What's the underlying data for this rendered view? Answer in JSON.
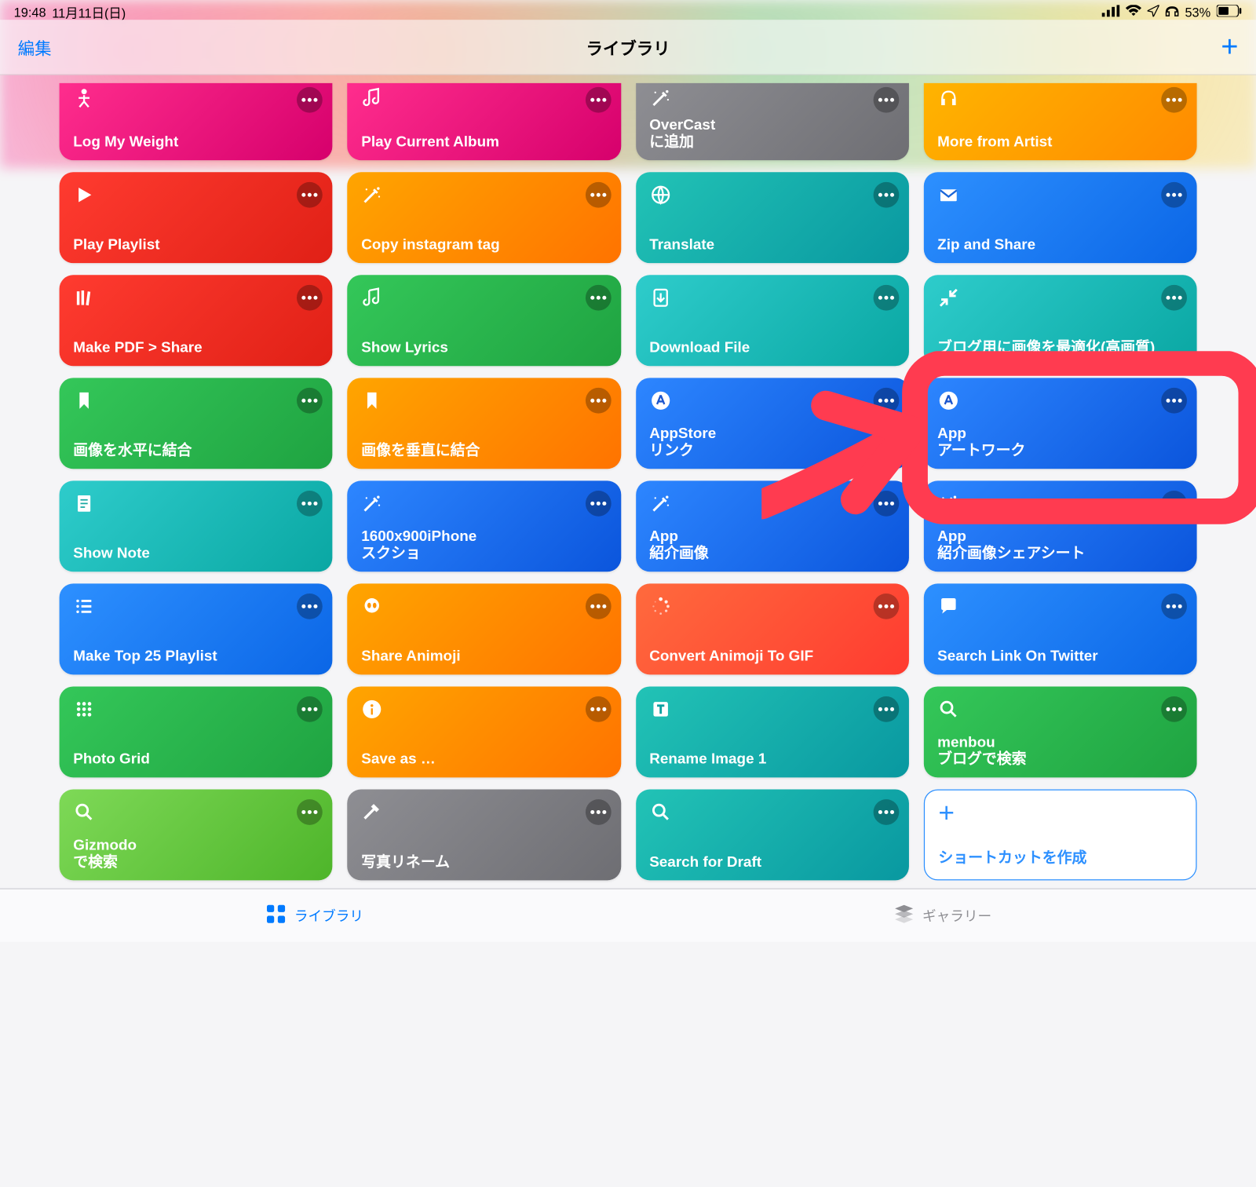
{
  "status": {
    "time": "19:48",
    "date": "11月11日(日)",
    "battery": "53%"
  },
  "nav": {
    "edit": "編集",
    "title": "ライブラリ"
  },
  "tiles": [
    {
      "label": "Log My Weight",
      "icon": "person",
      "cls": "g-pink",
      "row0": true
    },
    {
      "label": "Play Current Album",
      "icon": "music",
      "cls": "g-pink",
      "row0": true
    },
    {
      "label": "OverCast\nに追加",
      "icon": "wand",
      "cls": "g-gray",
      "row0": true
    },
    {
      "label": "More from Artist",
      "icon": "headphones",
      "cls": "g-yellow",
      "row0": true
    },
    {
      "label": "Play Playlist",
      "icon": "play",
      "cls": "g-red"
    },
    {
      "label": "Copy instagram tag",
      "icon": "wand",
      "cls": "g-orange"
    },
    {
      "label": "Translate",
      "icon": "globe",
      "cls": "g-tealdeep"
    },
    {
      "label": "Zip and Share",
      "icon": "mail",
      "cls": "g-blue"
    },
    {
      "label": "Make PDF > Share",
      "icon": "books",
      "cls": "g-red"
    },
    {
      "label": "Show Lyrics",
      "icon": "music",
      "cls": "g-green"
    },
    {
      "label": "Download File",
      "icon": "download",
      "cls": "g-teal"
    },
    {
      "label": "ブログ用に画像を最適化(高画質)",
      "icon": "shrink",
      "cls": "g-teal"
    },
    {
      "label": "画像を水平に結合",
      "icon": "bookmark",
      "cls": "g-green"
    },
    {
      "label": "画像を垂直に結合",
      "icon": "bookmark",
      "cls": "g-orange"
    },
    {
      "label": "AppStore\nリンク",
      "icon": "app",
      "cls": "g-blue2"
    },
    {
      "label": "App\nアートワーク",
      "icon": "app",
      "cls": "g-blue2"
    },
    {
      "label": "Show Note",
      "icon": "note",
      "cls": "g-teal"
    },
    {
      "label": "1600x900iPhone\nスクショ",
      "icon": "wand",
      "cls": "g-blue2"
    },
    {
      "label": "App\n紹介画像",
      "icon": "wand",
      "cls": "g-blue2"
    },
    {
      "label": "App\n紹介画像シェアシート",
      "icon": "wand",
      "cls": "g-blue2"
    },
    {
      "label": "Make Top 25 Playlist",
      "icon": "list",
      "cls": "g-blue"
    },
    {
      "label": "Share Animoji",
      "icon": "alien",
      "cls": "g-orange"
    },
    {
      "label": "Convert Animoji To GIF",
      "icon": "spinner",
      "cls": "g-redorange"
    },
    {
      "label": "Search Link On Twitter",
      "icon": "chat",
      "cls": "g-blue"
    },
    {
      "label": "Photo Grid",
      "icon": "grid",
      "cls": "g-green"
    },
    {
      "label": "Save as …",
      "icon": "info",
      "cls": "g-orange"
    },
    {
      "label": "Rename Image 1",
      "icon": "text",
      "cls": "g-tealdeep"
    },
    {
      "label": "menbou\nブログで検索",
      "icon": "search",
      "cls": "g-green"
    },
    {
      "label": "Gizmodo\nで検索",
      "icon": "search",
      "cls": "g-lgreen"
    },
    {
      "label": "写真リネーム",
      "icon": "hammer",
      "cls": "g-gray"
    },
    {
      "label": "Search for Draft",
      "icon": "search",
      "cls": "g-tealdeep"
    }
  ],
  "create": "ショートカットを作成",
  "tabs": {
    "library": "ライブラリ",
    "gallery": "ギャラリー"
  }
}
